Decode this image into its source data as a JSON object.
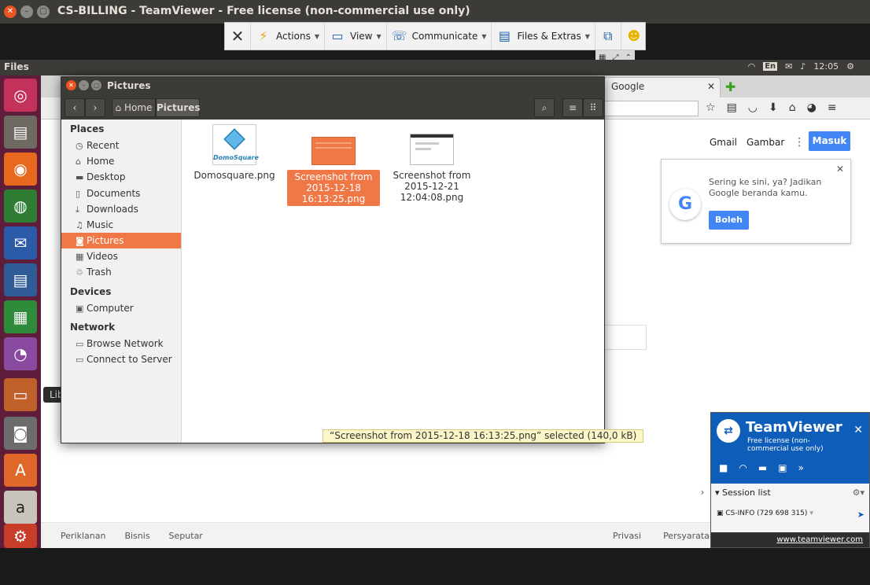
{
  "window": {
    "title": "CS-BILLING - TeamViewer - Free license (non-commercial use only)"
  },
  "tv_toolbar": {
    "close_icon": "close-icon",
    "actions": "Actions",
    "view": "View",
    "communicate": "Communicate",
    "files_extras": "Files & Extras"
  },
  "top_panel": {
    "app_name": "Files",
    "lang": "En",
    "time": "12:05"
  },
  "launcher": {
    "tooltip": "LibreOffice Impress"
  },
  "browser": {
    "tab_title": "Google",
    "gmail": "Gmail",
    "gambar": "Gambar",
    "masuk": "Masuk",
    "card_message": "Sering ke sini, ya? Jadikan Google beranda kamu.",
    "card_button": "Boleh",
    "footer_left": [
      "Periklanan",
      "Bisnis",
      "Seputar"
    ],
    "footer_right": [
      "Privasi",
      "Persyaratan"
    ]
  },
  "nautilus": {
    "title": "Pictures",
    "crumb_home": "Home",
    "crumb_current": "Pictures",
    "sidebar": {
      "places_header": "Places",
      "places": [
        "Recent",
        "Home",
        "Desktop",
        "Documents",
        "Downloads",
        "Music",
        "Pictures",
        "Videos",
        "Trash"
      ],
      "devices_header": "Devices",
      "devices": [
        "Computer"
      ],
      "network_header": "Network",
      "network": [
        "Browse Network",
        "Connect to Server"
      ]
    },
    "files": [
      {
        "name": "Domosquare.png"
      },
      {
        "name": "Screenshot from 2015-12-18 16:13:25.png"
      },
      {
        "name": "Screenshot from 2015-12-21 12:04:08.png"
      }
    ],
    "status": "“Screenshot from 2015-12-18 16:13:25.png” selected  (140,0 kB)",
    "accent": "#f07746"
  },
  "tv_panel": {
    "brand": "TeamViewer",
    "license": "Free license (non-commercial use only)",
    "session_header": "Session list",
    "session_entry": "CS-INFO (729 698 315)",
    "link": "www.teamviewer.com"
  }
}
